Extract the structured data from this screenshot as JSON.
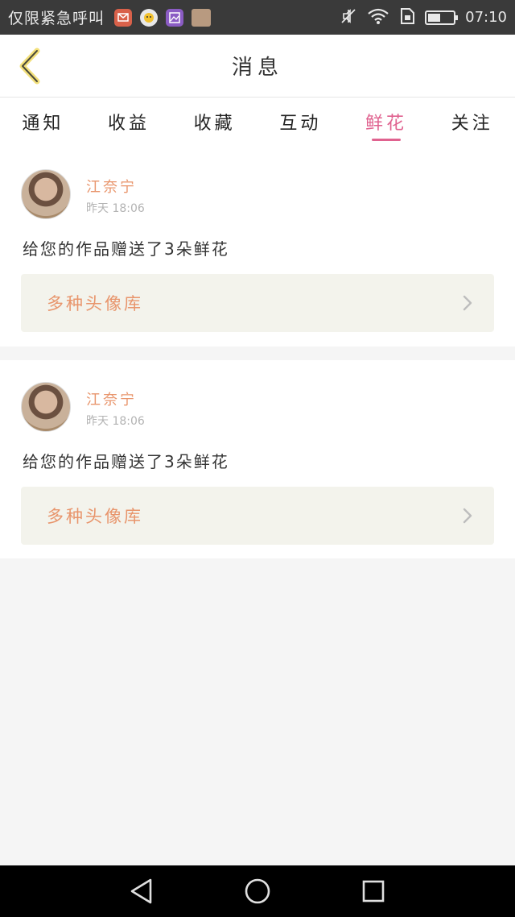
{
  "status_bar": {
    "text": "仅限紧急呼叫",
    "time": "07:10",
    "battery_level": 0.5
  },
  "header": {
    "title": "消息"
  },
  "tabs": [
    {
      "label": "通知",
      "active": false
    },
    {
      "label": "收益",
      "active": false
    },
    {
      "label": "收藏",
      "active": false
    },
    {
      "label": "互动",
      "active": false
    },
    {
      "label": "鲜花",
      "active": true
    },
    {
      "label": "关注",
      "active": false
    }
  ],
  "messages": [
    {
      "user_name": "江奈宁",
      "time": "昨天 18:06",
      "text": "给您的作品赠送了3朵鲜花",
      "link_label": "多种头像库"
    },
    {
      "user_name": "江奈宁",
      "time": "昨天 18:06",
      "text": "给您的作品赠送了3朵鲜花",
      "link_label": "多种头像库"
    }
  ],
  "colors": {
    "accent": "#e0628f",
    "name": "#e8956c",
    "link_bg": "#f3f3ec"
  }
}
